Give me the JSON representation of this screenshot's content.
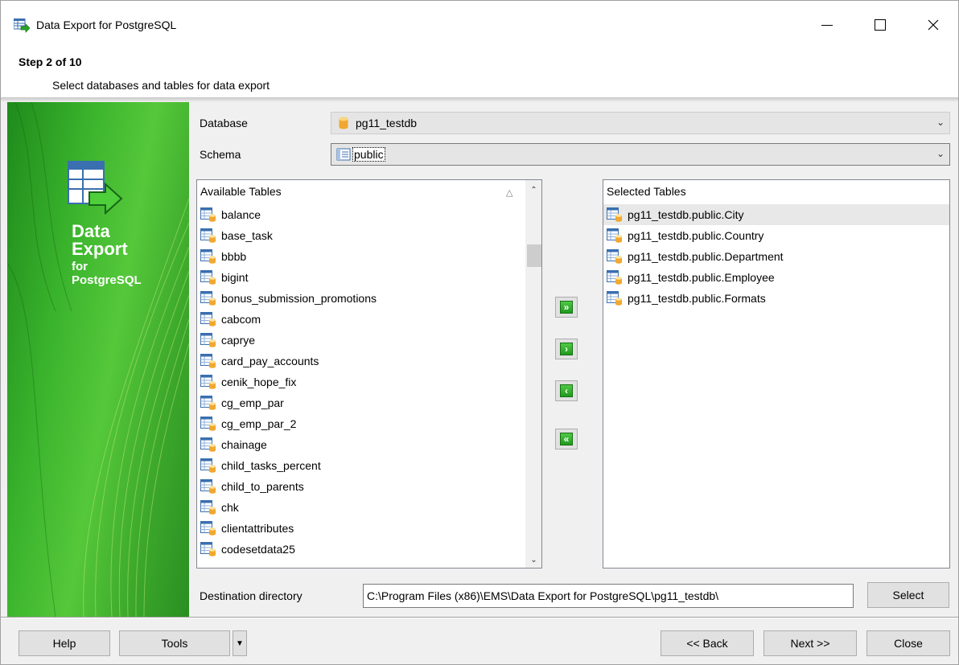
{
  "window": {
    "title": "Data Export for PostgreSQL"
  },
  "header": {
    "step": "Step 2 of 10",
    "description": "Select databases and tables for data export"
  },
  "banner": {
    "line1": "Data",
    "line2": "Export",
    "line3": "for",
    "line4": "PostgreSQL"
  },
  "form": {
    "database_label": "Database",
    "database_value": "pg11_testdb",
    "schema_label": "Schema",
    "schema_value": "public",
    "destination_label": "Destination directory",
    "destination_value": "C:\\Program Files (x86)\\EMS\\Data Export for PostgreSQL\\pg11_testdb\\",
    "select_button": "Select"
  },
  "available": {
    "header": "Available Tables",
    "items": [
      "balance",
      "base_task",
      "bbbb",
      "bigint",
      "bonus_submission_promotions",
      "cabcom",
      "caprye",
      "card_pay_accounts",
      "cenik_hope_fix",
      "cg_emp_par",
      "cg_emp_par_2",
      "chainage",
      "child_tasks_percent",
      "child_to_parents",
      "chk",
      "clientattributes",
      "codesetdata25"
    ]
  },
  "selected": {
    "header": "Selected Tables",
    "items": [
      "pg11_testdb.public.City",
      "pg11_testdb.public.Country",
      "pg11_testdb.public.Department",
      "pg11_testdb.public.Employee",
      "pg11_testdb.public.Formats"
    ]
  },
  "move_buttons": {
    "add_all": "»",
    "add": "›",
    "remove": "‹",
    "remove_all": "«"
  },
  "footer": {
    "help": "Help",
    "tools": "Tools",
    "back": "<< Back",
    "next": "Next >>",
    "close": "Close"
  },
  "colors": {
    "banner_green": "#39b22c",
    "button_green": "#1f9a1d"
  }
}
